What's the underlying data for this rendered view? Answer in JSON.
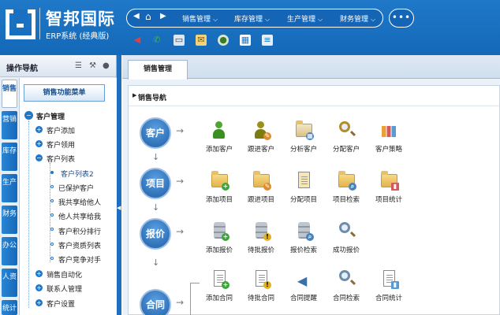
{
  "header": {
    "logo_title": "智邦国际",
    "logo_subtitle": "ERP系统 (经典版)",
    "nav_items": [
      {
        "label": "销售管理",
        "icon": "chevron-down-icon"
      },
      {
        "label": "库存管理",
        "icon": "chevron-down-icon"
      },
      {
        "label": "生产管理",
        "icon": "chevron-down-icon"
      },
      {
        "label": "财务管理",
        "icon": "chevron-down-icon"
      }
    ],
    "more_label": "•••",
    "back_label": "◀",
    "home_label": "⌂",
    "forward_label": "▶",
    "toolbar_icons": [
      "megaphone-icon",
      "phone-icon",
      "monitor-icon",
      "mail-icon",
      "chat-icon",
      "grid-icon",
      "notes-icon"
    ]
  },
  "sidebar": {
    "title": "操作导航",
    "tabs": [
      "销售",
      "营销",
      "库存",
      "生产",
      "财务",
      "办公",
      "人资",
      "统计"
    ],
    "menu_button": "销售功能菜单",
    "tree": {
      "root": "客户管理",
      "items": [
        {
          "label": "客户添加",
          "type": "node"
        },
        {
          "label": "客户领用",
          "type": "node"
        },
        {
          "label": "客户列表",
          "type": "open"
        },
        {
          "label": "客户列表2",
          "type": "leaf"
        },
        {
          "label": "已保护客户",
          "type": "leaf"
        },
        {
          "label": "我共享给他人",
          "type": "leaf"
        },
        {
          "label": "他人共享给我",
          "type": "leaf"
        },
        {
          "label": "客户积分排行",
          "type": "leaf"
        },
        {
          "label": "客户资质列表",
          "type": "leaf"
        },
        {
          "label": "客户竞争对手",
          "type": "leaf"
        },
        {
          "label": "销售自动化",
          "type": "node"
        },
        {
          "label": "联系人管理",
          "type": "node"
        },
        {
          "label": "客户设置",
          "type": "node"
        }
      ]
    }
  },
  "main": {
    "tab_label": "销售管理",
    "panel_title": "销售导航",
    "flow_arrow": "→",
    "down_arrow": "↓",
    "stages": [
      {
        "label": "客户",
        "items": [
          {
            "label": "添加客户",
            "icon": "person-add-icon"
          },
          {
            "label": "跟进客户",
            "icon": "person-follow-icon"
          },
          {
            "label": "分析客户",
            "icon": "analyze-icon"
          },
          {
            "label": "分配客户",
            "icon": "assign-search-icon"
          },
          {
            "label": "客户策略",
            "icon": "strategy-chart-icon"
          }
        ]
      },
      {
        "label": "项目",
        "items": [
          {
            "label": "添加项目",
            "icon": "folder-add-icon"
          },
          {
            "label": "跟进项目",
            "icon": "folder-follow-icon"
          },
          {
            "label": "分配项目",
            "icon": "folder-assign-icon"
          },
          {
            "label": "项目检索",
            "icon": "folder-search-icon"
          },
          {
            "label": "项目统计",
            "icon": "folder-stats-icon"
          }
        ]
      },
      {
        "label": "报价",
        "items": [
          {
            "label": "添加报价",
            "icon": "database-add-icon"
          },
          {
            "label": "待批报价",
            "icon": "database-pending-icon"
          },
          {
            "label": "报价检索",
            "icon": "database-search-icon"
          },
          {
            "label": "成功报价",
            "icon": "magnifier-chart-icon"
          }
        ]
      },
      {
        "label": "合同",
        "items": [
          {
            "label": "添加合同",
            "icon": "document-add-icon"
          },
          {
            "label": "待批合同",
            "icon": "document-pending-icon"
          },
          {
            "label": "合同提醒",
            "icon": "speaker-icon"
          },
          {
            "label": "合同检索",
            "icon": "magnifier-icon"
          },
          {
            "label": "合同统计",
            "icon": "document-chart-icon"
          }
        ]
      }
    ]
  },
  "colors": {
    "header": "#1a6fc0",
    "accent": "#1e78cc",
    "sidebar_bg": "#e8eef5"
  }
}
